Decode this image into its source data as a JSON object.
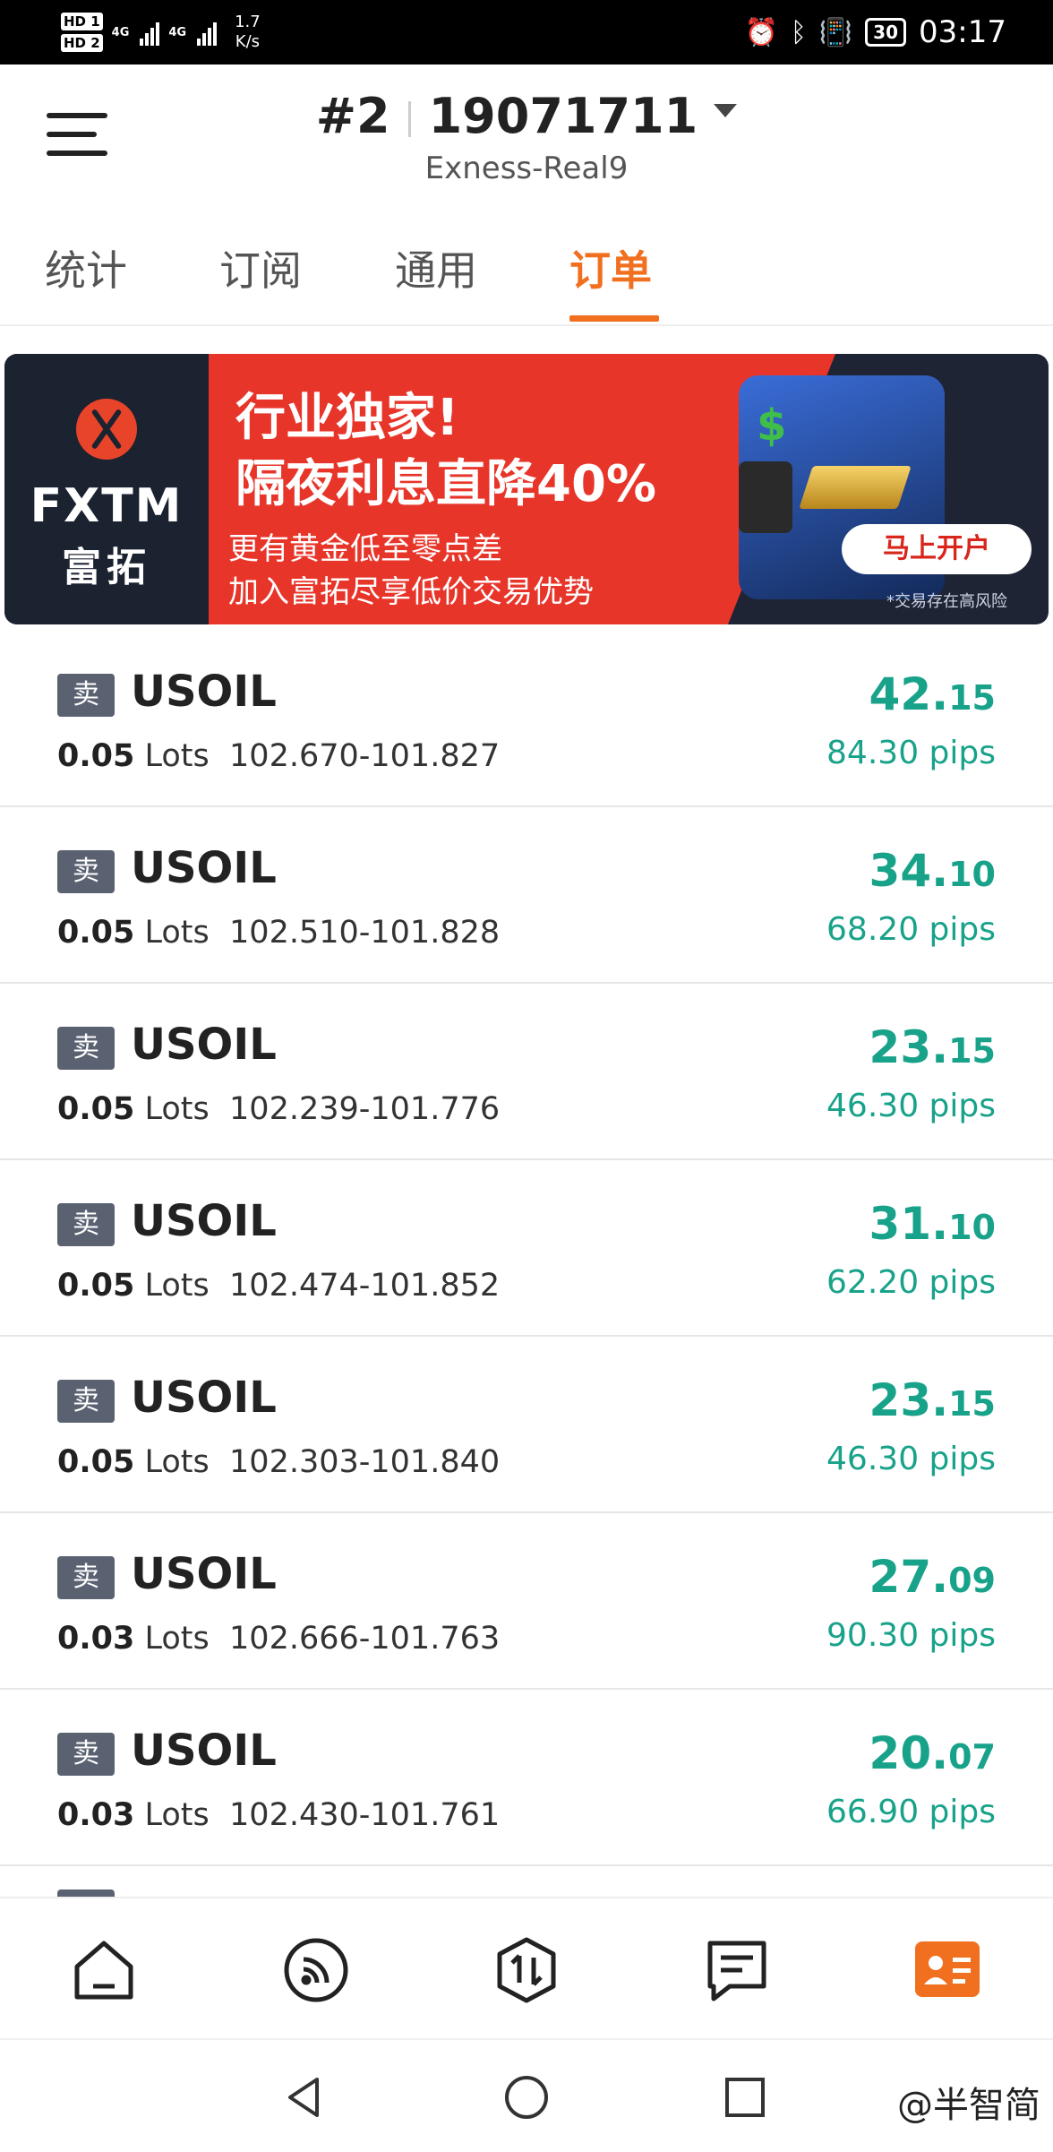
{
  "status_bar": {
    "hd1": "HD 1",
    "hd2": "HD 2",
    "net1": "4G",
    "net2": "4G",
    "speed_value": "1.7",
    "speed_unit": "K/s",
    "battery": "30",
    "time": "03:17"
  },
  "header": {
    "account_index": "#2",
    "account_number": "19071711",
    "server": "Exness-Real9"
  },
  "tabs": [
    {
      "label": "统计",
      "active": false
    },
    {
      "label": "订阅",
      "active": false
    },
    {
      "label": "通用",
      "active": false
    },
    {
      "label": "订单",
      "active": true
    }
  ],
  "banner": {
    "brand": "FXTM",
    "brand_cn": "富拓",
    "headline1": "行业独家!",
    "headline2": "隔夜利息直降40%",
    "sub1": "更有黄金低至零点差",
    "sub2": "加入富拓尽享低价交易优势",
    "cta": "马上开户",
    "disclaimer": "*交易存在高风险"
  },
  "orders": [
    {
      "side": "卖",
      "symbol": "USOIL",
      "lots": "0.05",
      "lots_unit": "Lots",
      "prices": "102.670-101.827",
      "profit_int": "42.",
      "profit_dec": "15",
      "pips": "84.30 pips"
    },
    {
      "side": "卖",
      "symbol": "USOIL",
      "lots": "0.05",
      "lots_unit": "Lots",
      "prices": "102.510-101.828",
      "profit_int": "34.",
      "profit_dec": "10",
      "pips": "68.20 pips"
    },
    {
      "side": "卖",
      "symbol": "USOIL",
      "lots": "0.05",
      "lots_unit": "Lots",
      "prices": "102.239-101.776",
      "profit_int": "23.",
      "profit_dec": "15",
      "pips": "46.30 pips"
    },
    {
      "side": "卖",
      "symbol": "USOIL",
      "lots": "0.05",
      "lots_unit": "Lots",
      "prices": "102.474-101.852",
      "profit_int": "31.",
      "profit_dec": "10",
      "pips": "62.20 pips"
    },
    {
      "side": "卖",
      "symbol": "USOIL",
      "lots": "0.05",
      "lots_unit": "Lots",
      "prices": "102.303-101.840",
      "profit_int": "23.",
      "profit_dec": "15",
      "pips": "46.30 pips"
    },
    {
      "side": "卖",
      "symbol": "USOIL",
      "lots": "0.03",
      "lots_unit": "Lots",
      "prices": "102.666-101.763",
      "profit_int": "27.",
      "profit_dec": "09",
      "pips": "90.30 pips"
    },
    {
      "side": "卖",
      "symbol": "USOIL",
      "lots": "0.03",
      "lots_unit": "Lots",
      "prices": "102.430-101.761",
      "profit_int": "20.",
      "profit_dec": "07",
      "pips": "66.90 pips"
    }
  ],
  "bottom_nav": [
    {
      "icon": "home-icon",
      "active": false
    },
    {
      "icon": "signal-feed-icon",
      "active": false
    },
    {
      "icon": "trade-icon",
      "active": false
    },
    {
      "icon": "chat-icon",
      "active": false
    },
    {
      "icon": "account-card-icon",
      "active": true
    }
  ],
  "watermark": "@半智简",
  "colors": {
    "accent": "#f07020",
    "profit": "#18a28a",
    "badge": "#5a6272"
  }
}
